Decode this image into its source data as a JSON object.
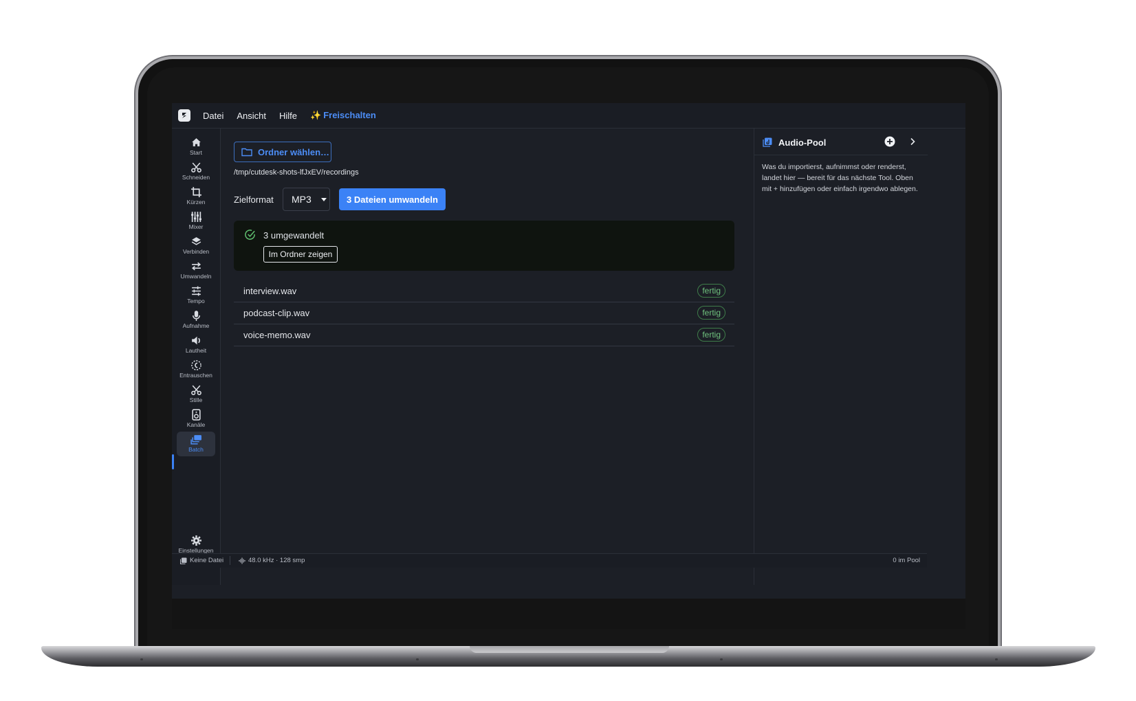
{
  "menu": {
    "items": [
      "Datei",
      "Ansicht",
      "Hilfe"
    ],
    "unlock_icon": "✨",
    "unlock_label": "Freischalten"
  },
  "sidebar": {
    "items": [
      {
        "label": "Start",
        "icon": "home-icon"
      },
      {
        "label": "Schneiden",
        "icon": "scissors-icon"
      },
      {
        "label": "Kürzen",
        "icon": "crop-icon"
      },
      {
        "label": "Mixer",
        "icon": "mixer-icon"
      },
      {
        "label": "Verbinden",
        "icon": "layers-icon"
      },
      {
        "label": "Umwandeln",
        "icon": "swap-icon"
      },
      {
        "label": "Tempo",
        "icon": "sliders-icon"
      },
      {
        "label": "Aufnahme",
        "icon": "microphone-icon"
      },
      {
        "label": "Lautheit",
        "icon": "speaker-icon"
      },
      {
        "label": "Entrauschen",
        "icon": "denoise-icon"
      },
      {
        "label": "Stille",
        "icon": "scissors-icon"
      },
      {
        "label": "Kanäle",
        "icon": "speaker-box-icon"
      },
      {
        "label": "Batch",
        "icon": "batch-icon"
      }
    ],
    "active": "Batch",
    "settings_label": "Einstellungen"
  },
  "main": {
    "folder_button": "Ordner wählen…",
    "path": "/tmp/cutdesk-shots-lfJxEV/recordings",
    "format_label": "Zielformat",
    "format_value": "MP3",
    "convert_button": "3 Dateien umwandeln",
    "result": {
      "text": "3 umgewandelt",
      "show_button": "Im Ordner zeigen"
    },
    "files": [
      {
        "name": "interview.wav",
        "status": "fertig"
      },
      {
        "name": "podcast-clip.wav",
        "status": "fertig"
      },
      {
        "name": "voice-memo.wav",
        "status": "fertig"
      }
    ]
  },
  "pool": {
    "title": "Audio-Pool",
    "description": "Was du importierst, aufnimmst oder renderst, landet hier — bereit für das nächste Tool. Oben mit + hinzufügen oder einfach irgendwo ablegen."
  },
  "status": {
    "file": "Keine Datei",
    "rate": "48.0 kHz · 128 smp",
    "pool_count": "0 im Pool"
  },
  "colors": {
    "accent": "#3b82f6",
    "success": "#6fc27e",
    "background": "#1c1f26"
  }
}
